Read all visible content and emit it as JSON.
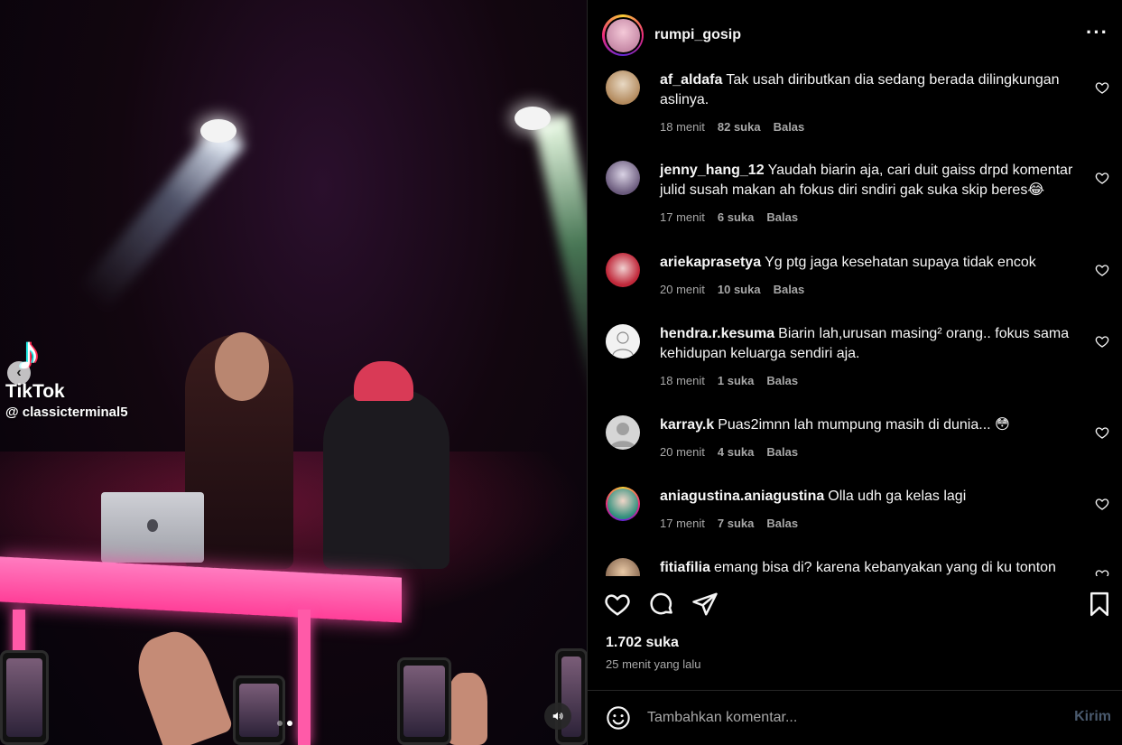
{
  "media": {
    "watermark_brand": "TikTok",
    "watermark_user": "@ classicterminal5",
    "carousel_dots": 2,
    "active_dot": 1
  },
  "post": {
    "username": "rumpi_gosip",
    "likes": "1.702 suka",
    "time_ago": "25 menit yang lalu"
  },
  "comments": [
    {
      "user": "af_aldafa",
      "text": "Tak usah diributkan dia sedang berada dilingkungan aslinya.",
      "time": "18 menit",
      "likes": "82 suka",
      "reply": "Balas"
    },
    {
      "user": "jenny_hang_12",
      "text": "Yaudah biarin aja, cari duit gaiss drpd komentar julid susah makan ah fokus diri sndiri gak suka skip beres😂",
      "time": "17 menit",
      "likes": "6 suka",
      "reply": "Balas"
    },
    {
      "user": "ariekaprasetya",
      "text": "Yg ptg jaga kesehatan supaya tidak encok",
      "time": "20 menit",
      "likes": "10 suka",
      "reply": "Balas"
    },
    {
      "user": "hendra.r.kesuma",
      "text": "Biarin lah,urusan masing² orang.. fokus sama kehidupan keluarga sendiri aja.",
      "time": "18 menit",
      "likes": "1 suka",
      "reply": "Balas"
    },
    {
      "user": "karray.k",
      "text": "Puas2imnn lah mumpung masih di dunia... 😳",
      "time": "20 menit",
      "likes": "4 suka",
      "reply": "Balas"
    },
    {
      "user": "aniagustina.aniagustina",
      "text": "Olla udh ga kelas lagi",
      "time": "17 menit",
      "likes": "7 suka",
      "reply": "Balas"
    },
    {
      "user": "fitiafilia",
      "text": "emang bisa di? karena kebanyakan yang di ku tonton",
      "time": "",
      "likes": "",
      "reply": ""
    }
  ],
  "add_comment": {
    "placeholder": "Tambahkan komentar...",
    "send_label": "Kirim"
  },
  "colors": {
    "background": "#000000",
    "text_primary": "#f5f5f5",
    "text_secondary": "#a8a8a8",
    "send_disabled": "#4a5a6e",
    "divider": "#262626"
  }
}
